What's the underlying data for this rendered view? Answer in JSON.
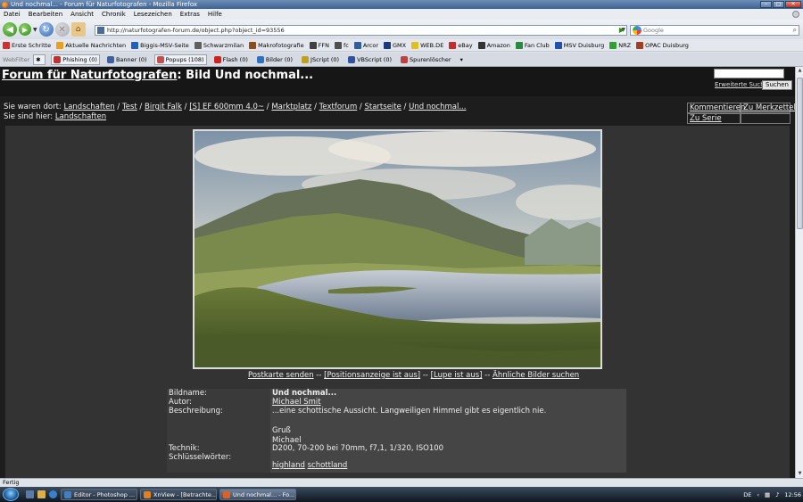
{
  "window": {
    "title": "Und nochmal... - Forum für Naturfotografen - Mozilla Firefox"
  },
  "menu": [
    "Datei",
    "Bearbeiten",
    "Ansicht",
    "Chronik",
    "Lesezeichen",
    "Extras",
    "Hilfe"
  ],
  "nav": {
    "url": "http://naturfotografen-forum.de/object.php?object_id=93556",
    "search_placeholder": "Google"
  },
  "bookmarks": [
    {
      "label": "Erste Schritte",
      "color": "#d03030"
    },
    {
      "label": "Aktuelle Nachrichten",
      "color": "#e8a020"
    },
    {
      "label": "Biggis-MSV-Seite",
      "color": "#2060c0"
    },
    {
      "label": "Schwarzmilan",
      "color": "#606060"
    },
    {
      "label": "Makrofotografie",
      "color": "#8a5020"
    },
    {
      "label": "FFN",
      "color": "#404040"
    },
    {
      "label": "fc",
      "color": "#505050"
    },
    {
      "label": "Arcor",
      "color": "#3060a0"
    },
    {
      "label": "GMX",
      "color": "#1a3a80"
    },
    {
      "label": "WEB.DE",
      "color": "#e0c020"
    },
    {
      "label": "eBay",
      "color": "#c03030"
    },
    {
      "label": "Amazon",
      "color": "#333333"
    },
    {
      "label": "Fan Club",
      "color": "#2a8a40"
    },
    {
      "label": "MSV Duisburg",
      "color": "#2050b0"
    },
    {
      "label": "NRZ",
      "color": "#30a030"
    },
    {
      "label": "OPAC Duisburg",
      "color": "#a04020"
    }
  ],
  "webfilter": {
    "label": "WebFilter",
    "items": [
      {
        "label": "Phishing (0)",
        "color": "#c03030",
        "boxed": true
      },
      {
        "label": "Banner (0)",
        "color": "#4060a0",
        "boxed": false
      },
      {
        "label": "Popups (108)",
        "color": "#c05050",
        "boxed": true
      },
      {
        "label": "Flash (0)",
        "color": "#d02020",
        "boxed": false
      },
      {
        "label": "Bilder (0)",
        "color": "#3070c0",
        "boxed": false
      },
      {
        "label": "JScript (0)",
        "color": "#c0a020",
        "boxed": false
      },
      {
        "label": "VBScript (0)",
        "color": "#3050a0",
        "boxed": false
      },
      {
        "label": "Spurenlöscher",
        "color": "#c04040",
        "boxed": false
      }
    ]
  },
  "page": {
    "site_link": "Forum für Naturfotografen",
    "title_suffix": ": Bild Und nochmal...",
    "search_button": "Suchen",
    "advanced_search": "Erweiterte Suche",
    "visited_label": "Sie waren dort:",
    "visited": [
      "Landschaften",
      "Test",
      "Birgit Falk",
      "[S] EF 600mm 4.0~",
      "Marktplatz",
      "Textforum",
      "Startseite",
      "Und nochmal..."
    ],
    "here_label": "Sie sind hier:",
    "here": "Landschaften",
    "side_menu": {
      "comment": "Kommentieren",
      "bookmark": "Zu Merkzettel",
      "series": "Zu Serie"
    },
    "photo_links": {
      "postcard": "Postkarte senden",
      "sep": "--",
      "position": "[Positionsanzeige ist aus]",
      "magnifier": "[Lupe ist aus]",
      "similar": "Ähnliche Bilder suchen"
    },
    "info": {
      "name_label": "Bildname:",
      "name": "Und nochmal...",
      "author_label": "Autor:",
      "author": "Michael Smit",
      "desc_label": "Beschreibung:",
      "desc_lines": [
        "...eine schottische Aussicht. Langweiligen Himmel gibt es eigentlich nie.",
        "",
        "Gruß",
        "Michael"
      ],
      "tech_label": "Technik:",
      "tech": "D200, 70-200 bei 70mm, f7,1, 1/320, ISO100",
      "keywords_label": "Schlüsselwörter:",
      "keywords": [
        "highland",
        "schottland"
      ]
    }
  },
  "status": "Fertig",
  "taskbar": {
    "tasks": [
      {
        "label": "Editor - Photoshop ...",
        "color": "#4080c0",
        "active": false
      },
      {
        "label": "XnView - [Betrachte...",
        "color": "#e08020",
        "active": false
      },
      {
        "label": "Und nochmal... - Fo...",
        "color": "#e06020",
        "active": true
      }
    ],
    "lang": "DE",
    "clock": "12:56"
  }
}
